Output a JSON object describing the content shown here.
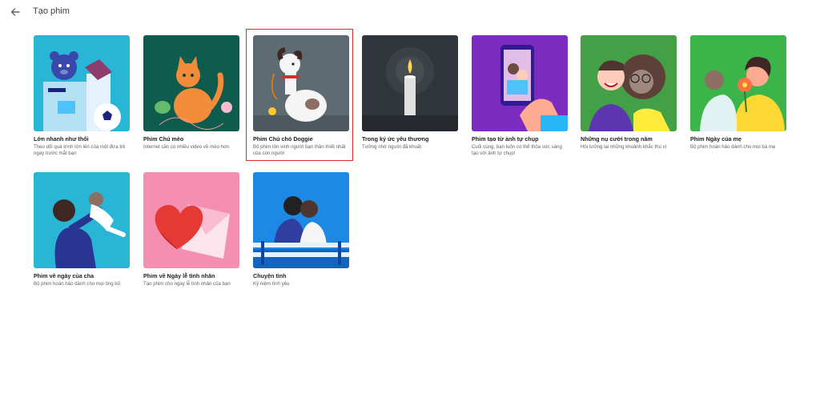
{
  "header": {
    "back_icon": "arrow-back-icon",
    "title": "Tạo phim"
  },
  "accent_color": "#d93025",
  "selected_card": "Phim Chú chó Doggie",
  "cards": [
    {
      "title": "Lớn nhanh như thổi",
      "description": "Theo dõi quá trình lớn lên của một đứa trẻ ngay trước mắt bạn",
      "bg": "#29b6d6"
    },
    {
      "title": "Phim Chú mèo",
      "description": "Internet cần có nhiều video về mèo hơn",
      "bg": "#0e5c4e"
    },
    {
      "title": "Phim Chú chó Doggie",
      "description": "Bộ phim tôn vinh người bạn thân thiết nhất của con người",
      "bg": "#5f6b73"
    },
    {
      "title": "Trong ký ức yêu thương",
      "description": "Tưởng nhớ người đã khuất",
      "bg": "#30363b"
    },
    {
      "title": "Phim tạo từ ảnh tự chụp",
      "description": "Cuối cùng, bạn luôn có thể thỏa sức sáng tạo với ảnh tự chụp!",
      "bg": "#7b2cbf"
    },
    {
      "title": "Những nụ cười trong năm",
      "description": "Hồi tưởng lại những khoảnh khắc thú vị",
      "bg": "#43a047"
    },
    {
      "title": "Phim Ngày của mẹ",
      "description": "Bộ phim hoàn hảo dành cho mọi bà mẹ",
      "bg": "#3bb54a"
    },
    {
      "title": "Phim về ngày của cha",
      "description": "Bộ phim hoàn hảo dành cho mọi ông bố",
      "bg": "#29b6d6"
    },
    {
      "title": "Phim về Ngày lễ tình nhân",
      "description": "Tạo phim cho ngày lễ tình nhân của bạn",
      "bg": "#f48fb1"
    },
    {
      "title": "Chuyện tình",
      "description": "Kỷ niệm tình yêu",
      "bg": "#1e88e5"
    }
  ]
}
